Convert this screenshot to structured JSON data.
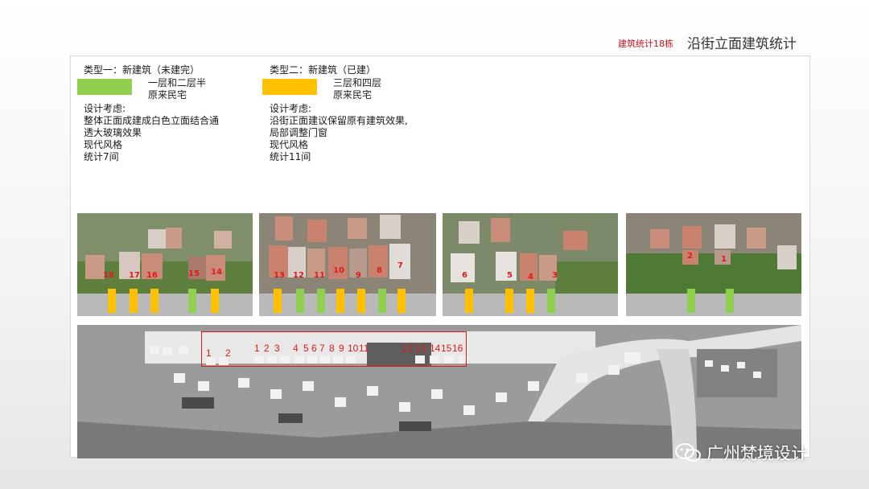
{
  "header": {
    "subtitle": "建筑统计18栋",
    "title": "沿街立面建筑统计"
  },
  "type1": {
    "title": "类型一：新建筑（未建完）",
    "legend_line1": "一层和二层半",
    "legend_line2": "原来民宅",
    "consider_title": "设计考虑:",
    "lines": [
      "整体正面成建成白色立面结合通",
      "透大玻璃效果",
      "现代风格",
      "统计7间"
    ],
    "color": "#8fd14f"
  },
  "type2": {
    "title": "类型二：新建筑（已建）",
    "legend_line1": "三层和四层",
    "legend_line2": "原来民宅",
    "consider_title": "设计考虑:",
    "lines": [
      "沿街正面建议保留原有建筑效果,",
      "局部调整门窗",
      "现代风格",
      "统计11间"
    ],
    "color": "#ffc000"
  },
  "photos": [
    {
      "labels": [
        "18",
        "17",
        "16",
        "15",
        "14"
      ],
      "markers": [
        "yellow",
        "yellow",
        "yellow",
        "green",
        "yellow"
      ]
    },
    {
      "labels": [
        "13",
        "12",
        "11",
        "10",
        "9",
        "8",
        "7"
      ],
      "markers": [
        "yellow",
        "green",
        "green",
        "yellow",
        "yellow",
        "green",
        "yellow"
      ]
    },
    {
      "labels": [
        "6",
        "5",
        "4",
        "3"
      ],
      "markers": [
        "yellow",
        "yellow",
        "yellow",
        "green"
      ]
    },
    {
      "labels": [
        "2",
        "1"
      ],
      "markers": [
        "green",
        "green"
      ]
    }
  ],
  "map": {
    "numbers": [
      "1",
      "2",
      "1",
      "2",
      "3",
      "4",
      "5",
      "6",
      "7",
      "8",
      "9",
      "10",
      "11",
      "12",
      "13",
      "14",
      "15",
      "16"
    ]
  },
  "watermark": {
    "text": "广州梵境设计",
    "icon": "wechat-icon"
  }
}
